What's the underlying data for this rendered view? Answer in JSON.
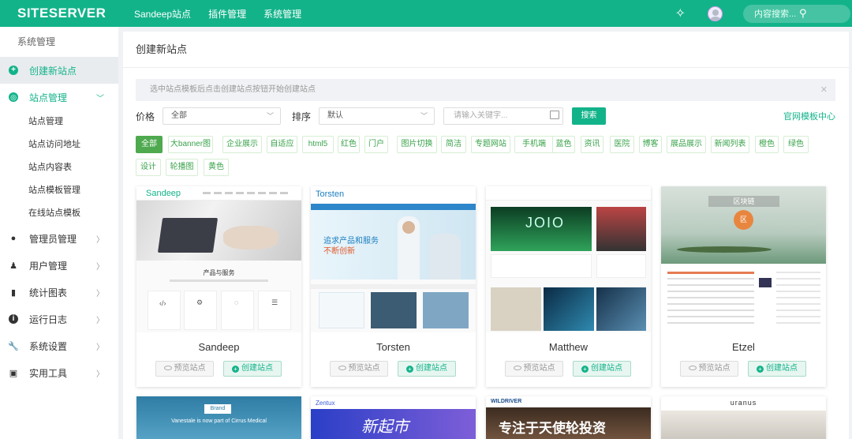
{
  "topbar": {
    "logo": "SITESERVER",
    "nav": [
      "Sandeep站点",
      "插件管理",
      "系统管理"
    ],
    "search_placeholder": "内容搜索..."
  },
  "sidebar": {
    "header": "系统管理",
    "items": [
      {
        "label": "创建新站点",
        "icon": "plus-circle-icon"
      },
      {
        "label": "站点管理",
        "icon": "globe-icon"
      },
      {
        "label": "管理员管理",
        "icon": "user-icon"
      },
      {
        "label": "用户管理",
        "icon": "users-icon"
      },
      {
        "label": "统计图表",
        "icon": "bar-chart-icon"
      },
      {
        "label": "运行日志",
        "icon": "info-icon"
      },
      {
        "label": "系统设置",
        "icon": "wrench-icon"
      },
      {
        "label": "实用工具",
        "icon": "briefcase-icon"
      }
    ],
    "sub_items": [
      "站点管理",
      "站点访问地址",
      "站点内容表",
      "站点模板管理",
      "在线站点模板"
    ]
  },
  "content": {
    "title": "创建新站点",
    "alert": "选中站点模板后点击创建站点按钮开始创建站点",
    "price_label": "价格",
    "price_value": "全部",
    "sort_label": "排序",
    "sort_value": "默认",
    "keyword_placeholder": "请输入关键字...",
    "search_button": "搜索",
    "official_link": "官网模板中心",
    "tags": [
      "全部",
      "大banner图",
      "企业展示",
      "自适应",
      "html5",
      "红色",
      "门户",
      "图片切换",
      "简洁",
      "专题网站",
      "手机端",
      "蓝色",
      "资讯",
      "医院",
      "博客",
      "展品展示",
      "新闻列表",
      "橙色",
      "绿色",
      "设计",
      "轮播图",
      "黄色"
    ],
    "preview_label": "预览站点",
    "create_label": "创建站点",
    "cards": [
      {
        "name": "Sandeep",
        "brand": "Sandeep",
        "headline": "产品与服务"
      },
      {
        "name": "Torsten",
        "brand": "Torsten",
        "headline": "追求产品和服务",
        "headline2": "不断创新"
      },
      {
        "name": "Matthew",
        "brand": "",
        "headline": "JOIO"
      },
      {
        "name": "Etzel",
        "brand": "",
        "headline": "区块链",
        "badge": "区"
      }
    ],
    "row2": [
      {
        "brand": "Brand",
        "tagline": "Vanestale is now part of Cirrus Medical"
      },
      {
        "brand": "Zentux",
        "banner": "新起市"
      },
      {
        "brand": "WILDRIVER",
        "banner": "专注于天使轮投资"
      },
      {
        "brand": "uranus"
      }
    ]
  },
  "colors": {
    "accent": "#13b38a",
    "tag_green": "#4ea94f"
  }
}
